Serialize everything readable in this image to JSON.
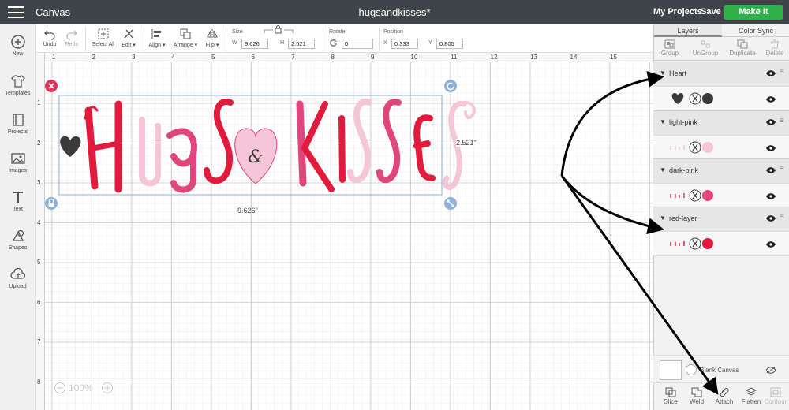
{
  "topbar": {
    "app_title": "Canvas",
    "doc_title": "hugsandkisses*",
    "my_projects": "My Projects",
    "save": "Save",
    "make_it": "Make It"
  },
  "toolbar": {
    "undo": "Undo",
    "redo": "Redo",
    "select_all": "Select All",
    "edit": "Edit ▾",
    "align": "Align ▾",
    "arrange": "Arrange ▾",
    "flip": "Flip ▾",
    "size_label": "Size",
    "w_label": "W",
    "w_value": "9.626",
    "h_label": "H",
    "h_value": "2.521",
    "rotate_label": "Rotate",
    "rotate_value": "0",
    "position_label": "Position",
    "x_label": "X",
    "x_value": "0.333",
    "y_label": "Y",
    "y_value": "0.805"
  },
  "sidebar": {
    "items": [
      {
        "label": "New",
        "icon": "plus-circle-icon"
      },
      {
        "label": "Templates",
        "icon": "shirt-icon"
      },
      {
        "label": "Projects",
        "icon": "book-icon"
      },
      {
        "label": "Images",
        "icon": "image-icon"
      },
      {
        "label": "Text",
        "icon": "text-t-icon"
      },
      {
        "label": "Shapes",
        "icon": "shapes-icon"
      },
      {
        "label": "Upload",
        "icon": "cloud-upload-icon"
      }
    ]
  },
  "ruler": {
    "h": [
      "1",
      "2",
      "3",
      "4",
      "5",
      "6",
      "7",
      "8",
      "9",
      "10",
      "11",
      "12",
      "13",
      "14",
      "15"
    ],
    "v": [
      "1",
      "2",
      "3",
      "4",
      "5",
      "6",
      "7",
      "8"
    ]
  },
  "canvas": {
    "width_readout": "9.626\"",
    "height_readout": "2.521\"",
    "zoom": "100%",
    "text_main": "Hugs",
    "text_heart": "&",
    "text_end": "KISSES"
  },
  "panel": {
    "tab_layers": "Layers",
    "tab_color_sync": "Color Sync",
    "actions": [
      "Group",
      "UnGroup",
      "Duplicate",
      "Delete"
    ],
    "layers": [
      {
        "name": "Heart",
        "color": "#3a3a3a"
      },
      {
        "name": "light-pink",
        "color": "#f4c6d7"
      },
      {
        "name": "dark-pink",
        "color": "#e0457b"
      },
      {
        "name": "red-layer",
        "color": "#e21b3c"
      }
    ],
    "blank_canvas": "Blank Canvas",
    "bottom_actions": [
      "Slice",
      "Weld",
      "Attach",
      "Flatten",
      "Contour"
    ]
  },
  "colors": {
    "topbar": "#3e4448",
    "make_it": "#2fb04a",
    "red": "#e21b3c",
    "dark_pink": "#e0457b",
    "light_pink": "#f4c6d7",
    "heart": "#3a3a3a",
    "selection": "#8fb0d8"
  }
}
